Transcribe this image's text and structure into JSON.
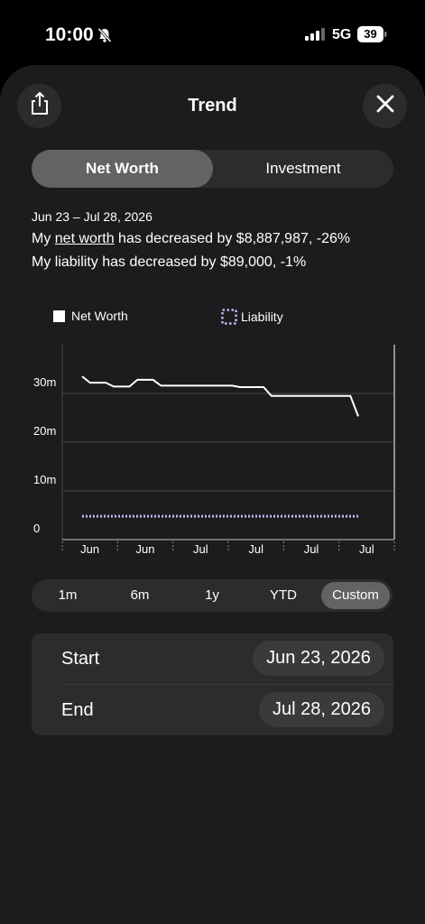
{
  "status": {
    "time": "10:00",
    "network": "5G",
    "battery": "39"
  },
  "sheet": {
    "title": "Trend"
  },
  "segment": {
    "items": [
      "Net Worth",
      "Investment"
    ],
    "selected": 0
  },
  "summary": {
    "range": "Jun 23 – Jul 28, 2026",
    "line1_prefix": "My ",
    "line1_link": "net worth",
    "line1_suffix": " has decreased by $8,887,987, -26%",
    "line2": "My liability has decreased by $89,000, -1%"
  },
  "legend": {
    "net_worth": "Net Worth",
    "liability": "Liability"
  },
  "chart_data": {
    "type": "line",
    "x_tick_labels": [
      "Jun",
      "Jun",
      "Jul",
      "Jul",
      "Jul",
      "Jul"
    ],
    "y_tick_labels": [
      "0",
      "10m",
      "20m",
      "30m"
    ],
    "ylim": [
      0,
      40
    ],
    "x_count": 36,
    "series": [
      {
        "name": "Net Worth",
        "color": "#ffffff",
        "style": "solid",
        "values": [
          33.5,
          32.2,
          32.2,
          32.2,
          31.4,
          31.4,
          31.4,
          32.8,
          32.8,
          32.8,
          31.6,
          31.6,
          31.6,
          31.6,
          31.6,
          31.6,
          31.6,
          31.6,
          31.6,
          31.6,
          31.3,
          31.3,
          31.3,
          31.3,
          29.5,
          29.5,
          29.5,
          29.5,
          29.5,
          29.5,
          29.5,
          29.5,
          29.5,
          29.5,
          29.5,
          25.3
        ]
      },
      {
        "name": "Liability",
        "color": "#b9b8f2",
        "style": "dotted",
        "values": [
          4.8,
          4.8,
          4.8,
          4.8,
          4.8,
          4.8,
          4.8,
          4.8,
          4.8,
          4.8,
          4.8,
          4.8,
          4.8,
          4.8,
          4.8,
          4.8,
          4.8,
          4.8,
          4.8,
          4.8,
          4.8,
          4.8,
          4.8,
          4.8,
          4.8,
          4.8,
          4.8,
          4.8,
          4.8,
          4.8,
          4.8,
          4.8,
          4.8,
          4.8,
          4.8,
          4.8
        ]
      }
    ]
  },
  "periods": {
    "items": [
      "1m",
      "6m",
      "1y",
      "YTD",
      "Custom"
    ],
    "selected": 4
  },
  "dates": {
    "start_label": "Start",
    "start_value": "Jun 23, 2026",
    "end_label": "End",
    "end_value": "Jul 28, 2026"
  }
}
